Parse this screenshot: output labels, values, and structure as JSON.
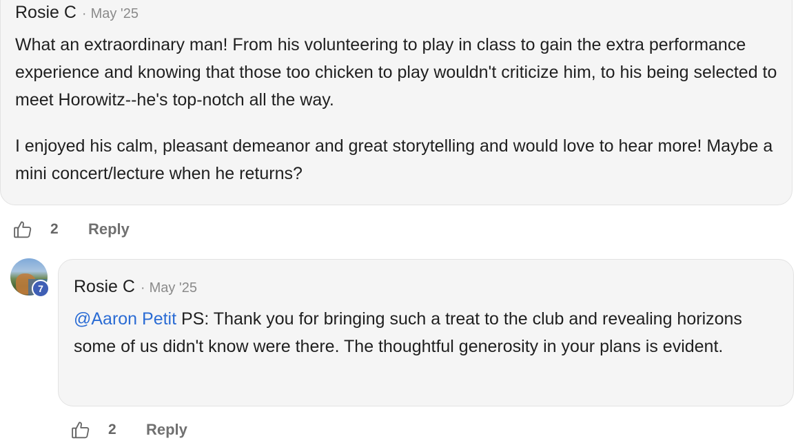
{
  "comment1": {
    "author": "Rosie C",
    "date": "May '25",
    "separator": "·",
    "paragraph1": "What an extraordinary man! From his volunteering to play in class to gain the extra performance experience and knowing that those too chicken to play wouldn't criticize him, to his being selected to meet Horowitz--he's top-notch all the way.",
    "paragraph2": "I enjoyed his calm, pleasant demeanor and great storytelling and would love to hear more! Maybe a mini concert/lecture when he returns?",
    "like_icon": "thumbs-up-icon",
    "like_count": "2",
    "reply_label": "Reply"
  },
  "comment2": {
    "author": "Rosie C",
    "date": "May '25",
    "separator": "·",
    "avatar_level": "7",
    "mention": "@Aaron Petit",
    "text": " PS: Thank you for bringing such a treat to the club and revealing horizons some of us didn't know were there. The thoughtful generosity in your plans is evident.",
    "like_icon": "thumbs-up-icon",
    "like_count": "2",
    "reply_label": "Reply"
  },
  "colors": {
    "bubble_bg": "#f5f5f5",
    "mention": "#2b6cd4",
    "level_badge": "#3f5fb5",
    "meta_text": "#8a8a8a"
  }
}
